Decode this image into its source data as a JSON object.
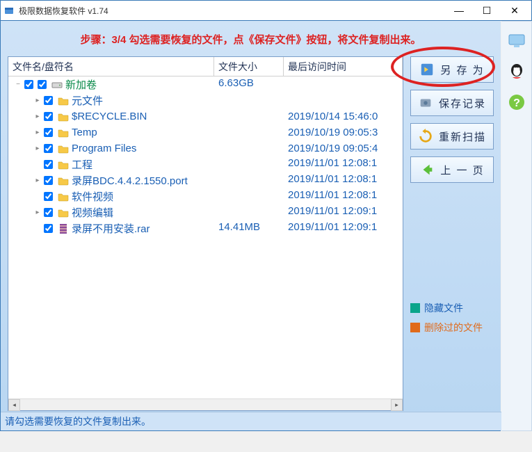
{
  "window": {
    "title": "极限数据恢复软件 v1.74"
  },
  "hint": "步骤：3/4 勾选需要恢复的文件，点《保存文件》按钮，将文件复制出来。",
  "columns": {
    "name": "文件名/盘符名",
    "size": "文件大小",
    "date": "最后访问时间"
  },
  "rows": [
    {
      "level": 0,
      "expand": "−",
      "type": "vol",
      "name": "新加卷",
      "size": "6.63GB",
      "date": ""
    },
    {
      "level": 1,
      "expand": "▸",
      "type": "folder",
      "name": "元文件",
      "size": "",
      "date": ""
    },
    {
      "level": 1,
      "expand": "▸",
      "type": "folder",
      "name": "$RECYCLE.BIN",
      "size": "",
      "date": "2019/10/14 15:46:0"
    },
    {
      "level": 1,
      "expand": "▸",
      "type": "folder",
      "name": "Temp",
      "size": "",
      "date": "2019/10/19 09:05:3"
    },
    {
      "level": 1,
      "expand": "▸",
      "type": "folder",
      "name": "Program Files",
      "size": "",
      "date": "2019/10/19 09:05:4"
    },
    {
      "level": 1,
      "expand": "",
      "type": "folder",
      "name": "工程",
      "size": "",
      "date": "2019/11/01 12:08:1"
    },
    {
      "level": 1,
      "expand": "▸",
      "type": "folder",
      "name": "录屏BDC.4.4.2.1550.port",
      "size": "",
      "date": "2019/11/01 12:08:1"
    },
    {
      "level": 1,
      "expand": "",
      "type": "folder",
      "name": "软件视频",
      "size": "",
      "date": "2019/11/01 12:08:1"
    },
    {
      "level": 1,
      "expand": "▸",
      "type": "folder",
      "name": "视频编辑",
      "size": "",
      "date": "2019/11/01 12:09:1"
    },
    {
      "level": 1,
      "expand": "",
      "type": "rar",
      "name": "录屏不用安装.rar",
      "size": "14.41MB",
      "date": "2019/11/01 12:09:1"
    }
  ],
  "buttons": {
    "save_as": "另 存 为",
    "save_log": "保存记录",
    "rescan": "重新扫描",
    "prev": "上 一 页"
  },
  "legend": {
    "hidden": "隐藏文件",
    "deleted": "删除过的文件"
  },
  "status": "请勾选需要恢复的文件复制出来。"
}
